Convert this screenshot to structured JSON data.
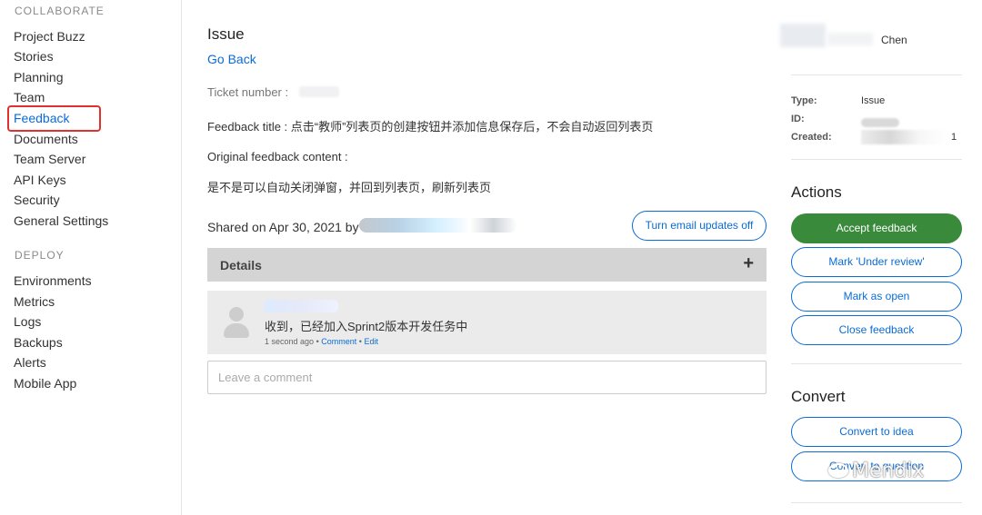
{
  "sidebar": {
    "collaborate_title": "COLLABORATE",
    "collaborate_items": [
      "Project Buzz",
      "Stories",
      "Planning",
      "Team",
      "Feedback",
      "Documents",
      "Team Server",
      "API Keys",
      "Security",
      "General Settings"
    ],
    "active_item": "Feedback",
    "deploy_title": "DEPLOY",
    "deploy_items": [
      "Environments",
      "Metrics",
      "Logs",
      "Backups",
      "Alerts",
      "Mobile App"
    ]
  },
  "main": {
    "title": "Issue",
    "go_back": "Go Back",
    "ticket_label": "Ticket number :",
    "feedback_title": "Feedback title : 点击“教师”列表页的创建按钮并添加信息保存后，不会自动返回列表页",
    "original_label": "Original feedback content :",
    "original_content": "是不是可以自动关闭弹窗，并回到列表页，刷新列表页",
    "shared_text": "Shared on Apr 30, 2021 by",
    "email_button": "Turn email updates off",
    "details_label": "Details",
    "details_toggle": "+",
    "comment": {
      "text": "收到，已经加入Sprint2版本开发任务中",
      "time": "1 second ago",
      "separator": "•",
      "comment_link": "Comment",
      "edit_link": "Edit"
    },
    "comment_placeholder": "Leave a comment"
  },
  "right": {
    "user_name": "Chen",
    "type_label": "Type:",
    "type_value": "Issue",
    "id_label": "ID:",
    "created_label": "Created:",
    "created_tail": "1",
    "actions_title": "Actions",
    "accept_button": "Accept feedback",
    "review_button": "Mark 'Under review'",
    "open_button": "Mark as open",
    "close_button": "Close feedback",
    "convert_title": "Convert",
    "convert_idea_button": "Convert to idea",
    "convert_question_button": "Convert to question"
  },
  "watermark": "Mendix",
  "colors": {
    "accent": "#0a6cd6",
    "success": "#3a8a3c",
    "highlight_box": "#e0312c"
  }
}
